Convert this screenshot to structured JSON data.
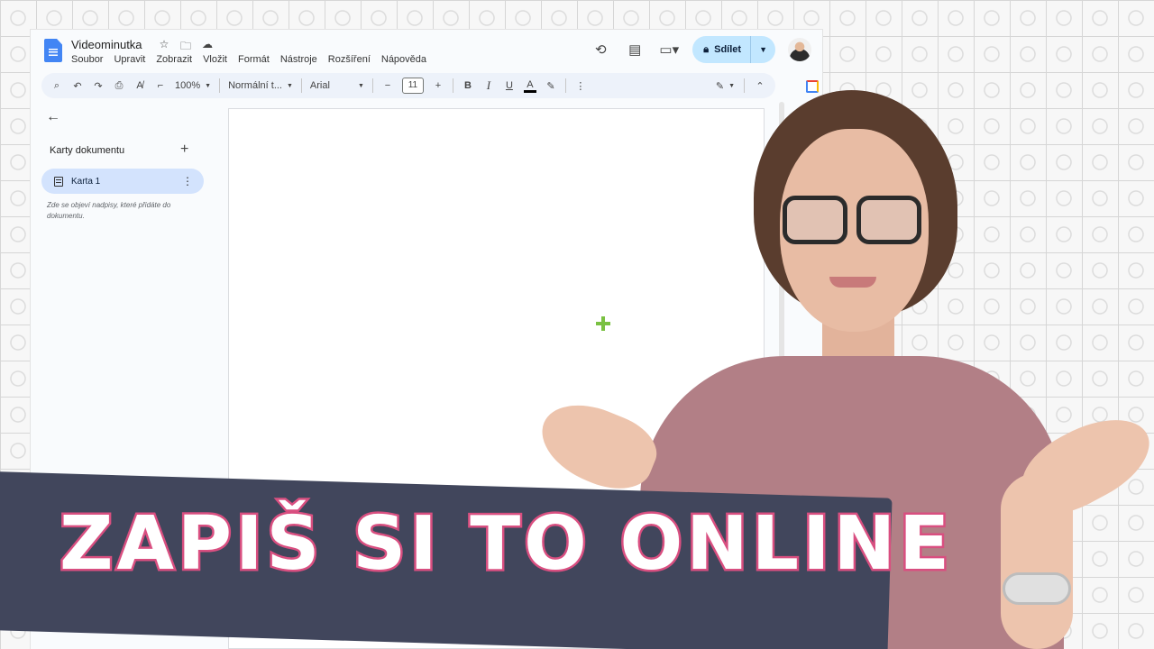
{
  "docs": {
    "title": "Videominutka",
    "title_icons": [
      "star-icon",
      "folder-move-icon",
      "cloud-saved-icon"
    ],
    "menu": [
      "Soubor",
      "Upravit",
      "Zobrazit",
      "Vložit",
      "Formát",
      "Nástroje",
      "Rozšíření",
      "Nápověda"
    ],
    "header_icons": [
      "history-icon",
      "comments-icon",
      "meet-icon"
    ],
    "share_label": "Sdílet",
    "toolbar": {
      "zoom": "100%",
      "style": "Normální t...",
      "font": "Arial",
      "font_size": "11",
      "bold": "B",
      "italic": "I",
      "underline": "U",
      "text_color": "A"
    },
    "sidebar": {
      "heading": "Karty dokumentu",
      "tab_label": "Karta 1",
      "hint": "Zde se objeví nadpisy, které přidáte do dokumentu."
    }
  },
  "banner": {
    "title": "ZAPIŠ SI TO ONLINE"
  },
  "colors": {
    "banner_bg": "#41465c",
    "title_stroke": "#d94f80",
    "share_bg": "#c2e7ff",
    "active_tab": "#d3e3fd"
  }
}
